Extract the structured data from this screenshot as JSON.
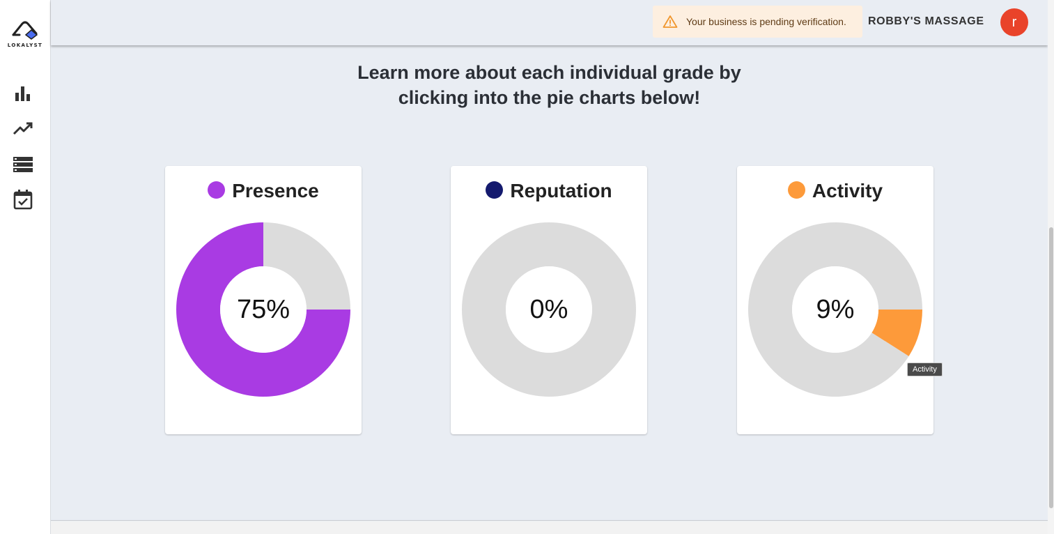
{
  "sidebar": {
    "logo_text": "LOKALYST",
    "items": [
      {
        "icon": "bar-chart-icon"
      },
      {
        "icon": "trending-up-icon"
      },
      {
        "icon": "list-icon"
      },
      {
        "icon": "calendar-check-icon"
      }
    ]
  },
  "header": {
    "alert_text": "Your business is pending verification.",
    "business_name": "ROBBY'S MASSAGE",
    "avatar_initial": "r"
  },
  "heading": {
    "line1": "Learn more about each individual grade by",
    "line2": "clicking into the pie charts below!"
  },
  "colors": {
    "presence": "#a93be3",
    "reputation": "#141a6e",
    "activity": "#fd9a3a",
    "empty": "#dcdcdc",
    "alert_bg": "#fdefe0",
    "avatar": "#e9432a"
  },
  "tooltip": "Activity",
  "chart_data": [
    {
      "type": "pie",
      "title": "Presence",
      "center_label": "75%",
      "values": [
        75,
        25
      ],
      "colors": [
        "#a93be3",
        "#dcdcdc"
      ]
    },
    {
      "type": "pie",
      "title": "Reputation",
      "center_label": "0%",
      "values": [
        0,
        100
      ],
      "colors": [
        "#141a6e",
        "#dcdcdc"
      ]
    },
    {
      "type": "pie",
      "title": "Activity",
      "center_label": "9%",
      "values": [
        9,
        91
      ],
      "colors": [
        "#fd9a3a",
        "#dcdcdc"
      ]
    }
  ]
}
